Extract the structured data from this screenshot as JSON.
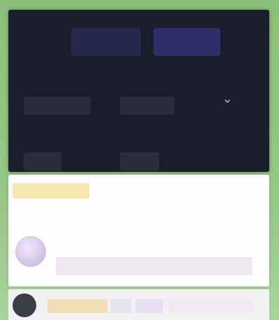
{
  "dark_panel": {
    "tabs": [
      "",
      ""
    ],
    "rows": [
      "",
      "",
      "",
      "",
      ""
    ],
    "chevron": "chevron-down-icon"
  },
  "card": {
    "badge": "",
    "row": ""
  },
  "bottom": {
    "label": "",
    "chips": [
      "",
      "",
      ""
    ]
  }
}
